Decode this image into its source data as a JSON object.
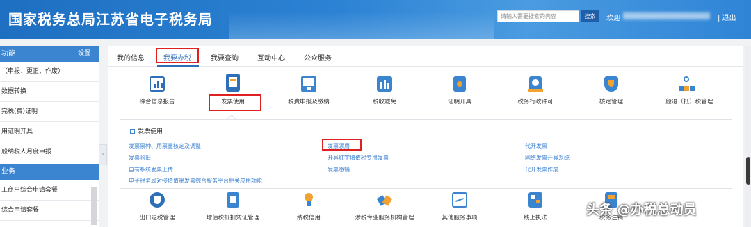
{
  "header": {
    "title": "国家税务总局江苏省电子税务局",
    "search_placeholder": "请输入需要搜索的内容",
    "search_button": "搜索",
    "welcome": "欢迎",
    "logout": "| 退出"
  },
  "sidebar": {
    "section1": "功能",
    "settings": "设置",
    "items": [
      "（申报、更正、作废）",
      "数据转换",
      "完税(费)证明",
      "用证明开具",
      "般纳税人月度申报"
    ],
    "section2": "业务",
    "items2": [
      "工商户综合申请套餐",
      "综合申请套餐"
    ]
  },
  "tabs": [
    "我的信息",
    "我要办税",
    "我要查询",
    "互动中心",
    "公众服务"
  ],
  "functions_row1": [
    {
      "label": "综合信息报告",
      "icon": "chart-report-icon"
    },
    {
      "label": "发票使用",
      "icon": "invoice-icon"
    },
    {
      "label": "税费申报及缴纳",
      "icon": "monitor-icon"
    },
    {
      "label": "税收减免",
      "icon": "reduction-icon"
    },
    {
      "label": "证明开具",
      "icon": "certificate-icon"
    },
    {
      "label": "税务行政许可",
      "icon": "admin-license-icon"
    },
    {
      "label": "核定管理",
      "icon": "shield-icon"
    },
    {
      "label": "一般退（抵）税管理",
      "icon": "org-tree-icon"
    }
  ],
  "submenu": {
    "title": "发票使用",
    "col1": [
      "发票票种、用票量核定及调整",
      "发票验旧",
      "自有系统发票上传",
      "电子税务局对接增值税发票综合服务平台相关应用功能"
    ],
    "col2": [
      "发票领用",
      "开具红字增值税专用发票",
      "发票缴销"
    ],
    "col3": [
      "代开发票",
      "网络发票开具系统",
      "代开发票作废"
    ]
  },
  "functions_row2": [
    {
      "label": "出口退税管理",
      "icon": "export-refund-icon"
    },
    {
      "label": "增值税抵扣凭证管理",
      "icon": "vat-deduction-icon"
    },
    {
      "label": "纳税信用",
      "icon": "bulb-icon"
    },
    {
      "label": "涉税专业服务机构管理",
      "icon": "handshake-icon"
    },
    {
      "label": "其他服务事项",
      "icon": "screen-icon"
    },
    {
      "label": "线上执法",
      "icon": "law-icon"
    },
    {
      "label": "税务注销",
      "icon": "cancel-icon"
    }
  ],
  "watermark": "头条 @办税总动员",
  "colors": {
    "header": "#2c82d4",
    "accent": "#3b84d0",
    "link": "#3a7fd0",
    "highlight": "#e02020"
  }
}
